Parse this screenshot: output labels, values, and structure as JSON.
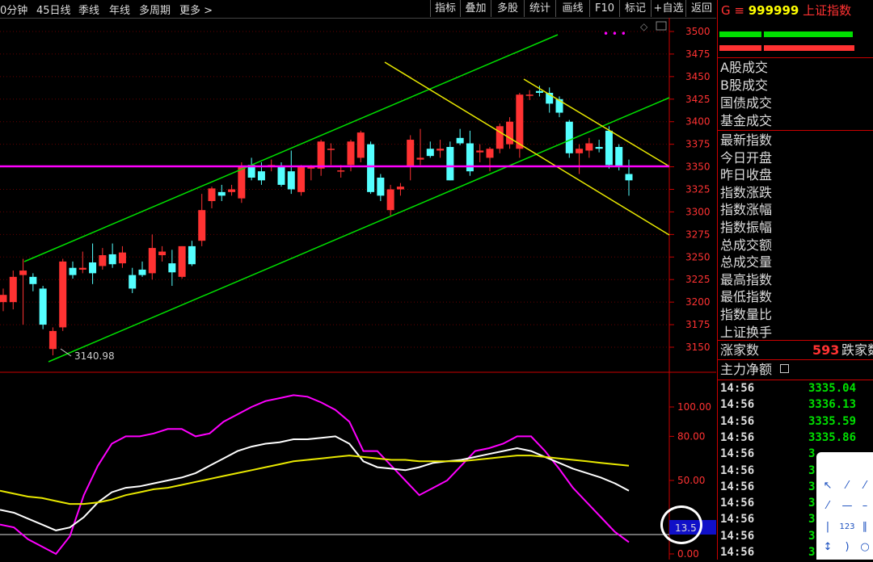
{
  "toolbar": {
    "periods": [
      "0分钟",
      "45日线",
      "季线",
      "年线",
      "多周期",
      "更多 >"
    ],
    "buttons": [
      "指标",
      "叠加",
      "多股",
      "统计",
      "画线",
      "F10",
      "标记",
      "+自选",
      "返回"
    ]
  },
  "price_chart": {
    "y_ticks": [
      "3500",
      "3475",
      "3450",
      "3425",
      "3400",
      "3375",
      "3350",
      "3325",
      "3300",
      "3275",
      "3250",
      "3225",
      "3200",
      "3175",
      "3150"
    ],
    "low_label": "3140.98",
    "dots_label": "• • •",
    "colors": {
      "up": "#ff3232",
      "down": "#54ffff",
      "channel": "#00e000",
      "trend": "#e8e800",
      "level": "#ff00ff"
    }
  },
  "indicator": {
    "y_ticks": [
      "100.00",
      "80.00",
      "50.00",
      "0.00"
    ],
    "current_value": "13.5"
  },
  "panel": {
    "code_prefix": "G ≡",
    "code": "999999",
    "name": "上证指数",
    "volume_labels": [
      "A股成交",
      "B股成交",
      "国债成交",
      "基金成交"
    ],
    "index_labels": [
      "最新指数",
      "今日开盘",
      "昨日收盘",
      "指数涨跌",
      "指数涨幅",
      "指数振幅",
      "总成交额",
      "总成交量",
      "最高指数",
      "最低指数",
      "指数量比",
      "上证换手"
    ],
    "up_count_label": "涨家数",
    "up_count": "593",
    "down_count_label": "跌家数",
    "net_flow_label": "主力净额",
    "ticks": [
      {
        "time": "14:56",
        "value": "3335.04"
      },
      {
        "time": "14:56",
        "value": "3336.13"
      },
      {
        "time": "14:56",
        "value": "3335.59"
      },
      {
        "time": "14:56",
        "value": "3335.86"
      },
      {
        "time": "14:56",
        "value": "3"
      },
      {
        "time": "14:56",
        "value": "3"
      },
      {
        "time": "14:56",
        "value": "3"
      },
      {
        "time": "14:56",
        "value": "3"
      },
      {
        "time": "14:56",
        "value": "3"
      },
      {
        "time": "14:56",
        "value": "3"
      },
      {
        "time": "14:56",
        "value": "3"
      }
    ]
  },
  "chart_data": {
    "type": "candlestick",
    "ylim": [
      3140,
      3500
    ],
    "candles": [
      {
        "o": 3200,
        "h": 3215,
        "l": 3190,
        "c": 3208
      },
      {
        "o": 3200,
        "h": 3235,
        "l": 3192,
        "c": 3228
      },
      {
        "o": 3230,
        "h": 3248,
        "l": 3175,
        "c": 3235
      },
      {
        "o": 3228,
        "h": 3232,
        "l": 3212,
        "c": 3220
      },
      {
        "o": 3215,
        "h": 3218,
        "l": 3170,
        "c": 3175
      },
      {
        "o": 3148,
        "h": 3172,
        "l": 3141,
        "c": 3168
      },
      {
        "o": 3172,
        "h": 3248,
        "l": 3168,
        "c": 3245
      },
      {
        "o": 3238,
        "h": 3245,
        "l": 3226,
        "c": 3230
      },
      {
        "o": 3236,
        "h": 3256,
        "l": 3232,
        "c": 3238
      },
      {
        "o": 3244,
        "h": 3265,
        "l": 3220,
        "c": 3232
      },
      {
        "o": 3240,
        "h": 3260,
        "l": 3236,
        "c": 3252
      },
      {
        "o": 3253,
        "h": 3265,
        "l": 3238,
        "c": 3242
      },
      {
        "o": 3243,
        "h": 3262,
        "l": 3238,
        "c": 3255
      },
      {
        "o": 3230,
        "h": 3238,
        "l": 3210,
        "c": 3215
      },
      {
        "o": 3236,
        "h": 3245,
        "l": 3228,
        "c": 3230
      },
      {
        "o": 3232,
        "h": 3275,
        "l": 3225,
        "c": 3260
      },
      {
        "o": 3252,
        "h": 3262,
        "l": 3245,
        "c": 3256
      },
      {
        "o": 3243,
        "h": 3258,
        "l": 3218,
        "c": 3233
      },
      {
        "o": 3228,
        "h": 3262,
        "l": 3226,
        "c": 3262
      },
      {
        "o": 3262,
        "h": 3268,
        "l": 3240,
        "c": 3242
      },
      {
        "o": 3268,
        "h": 3320,
        "l": 3262,
        "c": 3302
      },
      {
        "o": 3312,
        "h": 3328,
        "l": 3304,
        "c": 3326
      },
      {
        "o": 3322,
        "h": 3330,
        "l": 3312,
        "c": 3318
      },
      {
        "o": 3322,
        "h": 3330,
        "l": 3318,
        "c": 3325
      },
      {
        "o": 3315,
        "h": 3355,
        "l": 3310,
        "c": 3350
      },
      {
        "o": 3352,
        "h": 3360,
        "l": 3335,
        "c": 3338
      },
      {
        "o": 3345,
        "h": 3355,
        "l": 3330,
        "c": 3335
      },
      {
        "o": 3350,
        "h": 3358,
        "l": 3345,
        "c": 3352
      },
      {
        "o": 3350,
        "h": 3355,
        "l": 3328,
        "c": 3330
      },
      {
        "o": 3345,
        "h": 3368,
        "l": 3320,
        "c": 3325
      },
      {
        "o": 3322,
        "h": 3352,
        "l": 3318,
        "c": 3350
      },
      {
        "o": 3348,
        "h": 3352,
        "l": 3335,
        "c": 3350
      },
      {
        "o": 3348,
        "h": 3380,
        "l": 3340,
        "c": 3378
      },
      {
        "o": 3370,
        "h": 3376,
        "l": 3352,
        "c": 3370
      },
      {
        "o": 3345,
        "h": 3352,
        "l": 3338,
        "c": 3346
      },
      {
        "o": 3352,
        "h": 3380,
        "l": 3345,
        "c": 3378
      },
      {
        "o": 3360,
        "h": 3390,
        "l": 3355,
        "c": 3388
      },
      {
        "o": 3375,
        "h": 3378,
        "l": 3320,
        "c": 3322
      },
      {
        "o": 3338,
        "h": 3342,
        "l": 3312,
        "c": 3318
      },
      {
        "o": 3302,
        "h": 3330,
        "l": 3296,
        "c": 3325
      },
      {
        "o": 3325,
        "h": 3332,
        "l": 3318,
        "c": 3328
      },
      {
        "o": 3350,
        "h": 3385,
        "l": 3335,
        "c": 3380
      },
      {
        "o": 3358,
        "h": 3392,
        "l": 3352,
        "c": 3360
      },
      {
        "o": 3370,
        "h": 3378,
        "l": 3360,
        "c": 3362
      },
      {
        "o": 3368,
        "h": 3380,
        "l": 3360,
        "c": 3370
      },
      {
        "o": 3372,
        "h": 3378,
        "l": 3335,
        "c": 3335
      },
      {
        "o": 3382,
        "h": 3392,
        "l": 3374,
        "c": 3376
      },
      {
        "o": 3376,
        "h": 3390,
        "l": 3340,
        "c": 3345
      },
      {
        "o": 3366,
        "h": 3375,
        "l": 3355,
        "c": 3368
      },
      {
        "o": 3360,
        "h": 3372,
        "l": 3345,
        "c": 3370
      },
      {
        "o": 3370,
        "h": 3398,
        "l": 3365,
        "c": 3395
      },
      {
        "o": 3375,
        "h": 3405,
        "l": 3370,
        "c": 3400
      },
      {
        "o": 3370,
        "h": 3432,
        "l": 3360,
        "c": 3430
      },
      {
        "o": 3430,
        "h": 3435,
        "l": 3424,
        "c": 3430
      },
      {
        "o": 3434,
        "h": 3440,
        "l": 3428,
        "c": 3432
      },
      {
        "o": 3432,
        "h": 3438,
        "l": 3410,
        "c": 3420
      },
      {
        "o": 3425,
        "h": 3428,
        "l": 3405,
        "c": 3410
      },
      {
        "o": 3400,
        "h": 3402,
        "l": 3360,
        "c": 3365
      },
      {
        "o": 3365,
        "h": 3375,
        "l": 3342,
        "c": 3370
      },
      {
        "o": 3368,
        "h": 3382,
        "l": 3360,
        "c": 3376
      },
      {
        "o": 3372,
        "h": 3380,
        "l": 3366,
        "c": 3370
      },
      {
        "o": 3390,
        "h": 3395,
        "l": 3348,
        "c": 3352
      },
      {
        "o": 3372,
        "h": 3375,
        "l": 3346,
        "c": 3350
      },
      {
        "o": 3342,
        "h": 3358,
        "l": 3318,
        "c": 3335
      }
    ],
    "indicator_series": [
      {
        "name": "",
        "color": "#ff00ff",
        "values": [
          20,
          18,
          10,
          5,
          0,
          12,
          40,
          60,
          75,
          80,
          80,
          82,
          85,
          85,
          80,
          82,
          90,
          95,
          100,
          104,
          106,
          108,
          107,
          103,
          98,
          90,
          70,
          70,
          60,
          50,
          40,
          45,
          50,
          60,
          70,
          72,
          75,
          80,
          80,
          70,
          58,
          45,
          35,
          25,
          15,
          8
        ]
      },
      {
        "name": "",
        "color": "#ffffff",
        "values": [
          30,
          28,
          24,
          20,
          16,
          18,
          25,
          35,
          42,
          45,
          46,
          48,
          50,
          52,
          55,
          60,
          65,
          70,
          73,
          75,
          76,
          78,
          78,
          79,
          80,
          75,
          63,
          59,
          58,
          57,
          59,
          62,
          63,
          64,
          66,
          68,
          70,
          72,
          70,
          66,
          62,
          58,
          55,
          52,
          48,
          43
        ]
      },
      {
        "name": "",
        "color": "#e8e800",
        "values": [
          43,
          41,
          39,
          38,
          36,
          34,
          34,
          35,
          37,
          40,
          42,
          44,
          45,
          47,
          49,
          51,
          53,
          55,
          57,
          59,
          61,
          63,
          64,
          65,
          66,
          67,
          66,
          65,
          64,
          64,
          63,
          63,
          63,
          63,
          64,
          65,
          66,
          67,
          67,
          66,
          65,
          64,
          63,
          62,
          61,
          60
        ]
      }
    ]
  }
}
